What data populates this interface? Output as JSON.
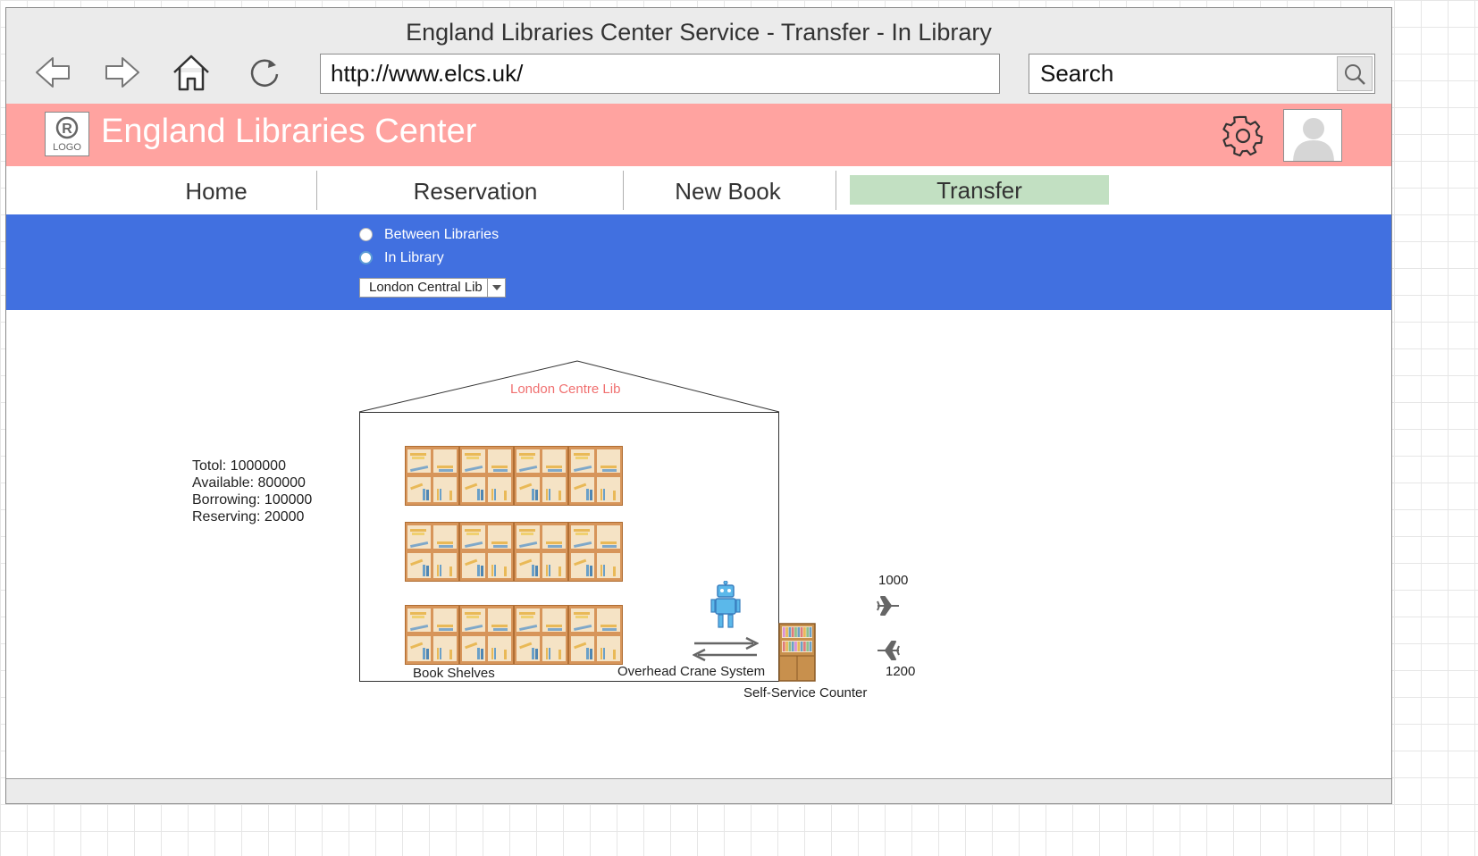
{
  "browser": {
    "window_title": "England Libraries Center Service - Transfer - In Library",
    "url": "http://www.elcs.uk/",
    "search_placeholder": "Search"
  },
  "header": {
    "logo_text": "LOGO",
    "app_name": "England Libraries Center"
  },
  "menu": {
    "items": [
      {
        "label": "Home"
      },
      {
        "label": "Reservation"
      },
      {
        "label": "New Book"
      },
      {
        "label": "Transfer",
        "active": true
      }
    ]
  },
  "transfer_options": {
    "radio_between": "Between Libraries",
    "radio_in_library": "In Library",
    "selected_radio": "In Library",
    "library_select_value": "London Central Lib"
  },
  "stats": {
    "total": "Totol: 1000000",
    "available": "Available: 800000",
    "borrowing": "Borrowing: 100000",
    "reserving": "Reserving: 20000"
  },
  "diagram": {
    "building_label": "London Centre Lib",
    "book_shelves_label": "Book Shelves",
    "crane_label": "Overhead Crane System",
    "counter_label": "Self-Service Counter",
    "outbound_count": "1000",
    "inbound_count": "1200"
  },
  "colors": {
    "header_bg": "#ffa3a0",
    "band_bg": "#4170e0",
    "active_tab_bg": "#c2e0c2",
    "building_label": "#f07070"
  }
}
